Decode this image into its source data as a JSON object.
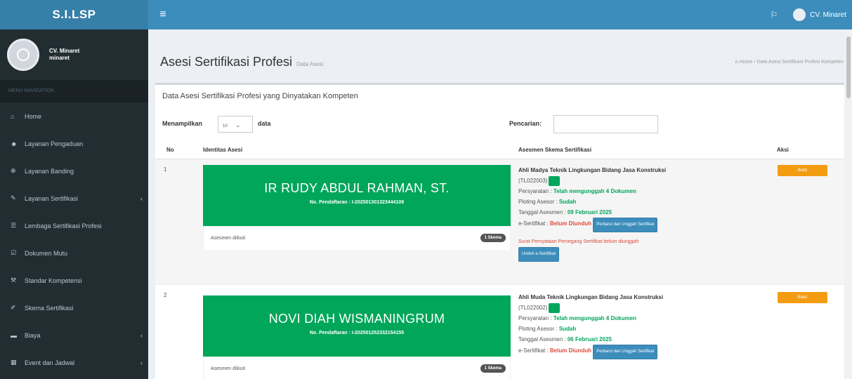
{
  "app": {
    "logo": "S.I.LSP",
    "toggle_icon": "≡"
  },
  "topbar": {
    "user_name": "CV. Minaret",
    "flag_icon": "⚐"
  },
  "sidebar": {
    "user": {
      "name_line1": "CV. Minaret",
      "name_line2": "minaret"
    },
    "header": "MENU NAVIGATION",
    "items": [
      {
        "label": "Home",
        "icon": "home-icon",
        "glyph": "⌂",
        "has_caret": false
      },
      {
        "label": "Layanan Pengaduan",
        "icon": "users-icon",
        "glyph": "☻",
        "has_caret": false
      },
      {
        "label": "Layanan Banding",
        "icon": "support-icon",
        "glyph": "⊕",
        "has_caret": false
      },
      {
        "label": "Layanan Sertifikasi",
        "icon": "certificate-icon",
        "glyph": "✎",
        "has_caret": true
      },
      {
        "label": "Lembaga Sertifikasi Profesi",
        "icon": "institution-icon",
        "glyph": "☰",
        "has_caret": false
      },
      {
        "label": "Dokumen Mutu",
        "icon": "document-icon",
        "glyph": "☑",
        "has_caret": false
      },
      {
        "label": "Standar Kompetensi",
        "icon": "wrench-icon",
        "glyph": "⚒",
        "has_caret": false
      },
      {
        "label": "Skema Sertifikasi",
        "icon": "edit-icon",
        "glyph": "✐",
        "has_caret": false
      },
      {
        "label": "Biaya",
        "icon": "money-icon",
        "glyph": "▬",
        "has_caret": true
      },
      {
        "label": "Event dan Jadwal",
        "icon": "calendar-icon",
        "glyph": "▦",
        "has_caret": true
      }
    ]
  },
  "page": {
    "title": "Asesi Sertifikasi Profesi",
    "subtitle": "Data Asesi",
    "breadcrumb_home": "Home",
    "breadcrumb_current": "Data Asesi Sertifikasi Profesi Kompeten"
  },
  "box": {
    "title": "Data Asesi Sertifikasi Profesi yang Dinyatakan Kompeten",
    "show_label": "Menampilkan",
    "show_value": "10",
    "show_suffix": "data",
    "search_label": "Pencarian:",
    "search_value": ""
  },
  "table": {
    "headers": {
      "no": "No",
      "identity": "Identitas Asesi",
      "assessment": "Asesmen Skema Sertifikasi",
      "action": "Aksi"
    },
    "rows": [
      {
        "no": "1",
        "name": "IR RUDY ABDUL RAHMAN, ST.",
        "reg": "No. Pendaftaran : I-202501301323444109",
        "followed_label": "Asesmen diikuti",
        "badge": "1 Skema",
        "scheme": "Ahli Madya Teknik Lingkungan Bidang Jasa Konstruksi",
        "code": "(TL022003)",
        "req_label": "Persyaratan : ",
        "req_value": "Telah mengunggah 4 Dokumen",
        "plot_label": "Ploting Asesor : ",
        "plot_value": "Sudah",
        "date_label": "Tanggal Asesmen : ",
        "date_value": "09 Februari 2025",
        "cert_label": "e-Sertifikat : ",
        "cert_value": "Belum Diunduh",
        "cert_button": "Perbarui dan Unggah Sertifikat",
        "note": "Surat Pernyataan Pemegang Sertifikat belum diunggah",
        "download_button": "Unduh e-Sertifikat",
        "action_button": "Bukti"
      },
      {
        "no": "2",
        "name": "NOVI DIAH WISMANINGRUM",
        "reg": "No. Pendaftaran : I-202501252332154155",
        "followed_label": "Asesmen diikuti",
        "badge": "1 Skema",
        "scheme": "Ahli Muda Teknik Lingkungan Bidang Jasa Konstruksi",
        "code": "(TL022002)",
        "req_label": "Persyaratan : ",
        "req_value": "Telah mengunggah 4 Dokumen",
        "plot_label": "Ploting Asesor : ",
        "plot_value": "Sudah",
        "date_label": "Tanggal Asesmen : ",
        "date_value": "06 Februari 2025",
        "cert_label": "e-Sertifikat : ",
        "cert_value": "Belum Diunduh",
        "cert_button": "Perbarui dan Unggah Sertifikat",
        "action_button": "Bukti"
      }
    ]
  },
  "colors": {
    "primary": "#3c8dbc",
    "success": "#00a65a",
    "warning": "#f39c12",
    "danger": "#dd4b39",
    "sidebar": "#222d32"
  }
}
